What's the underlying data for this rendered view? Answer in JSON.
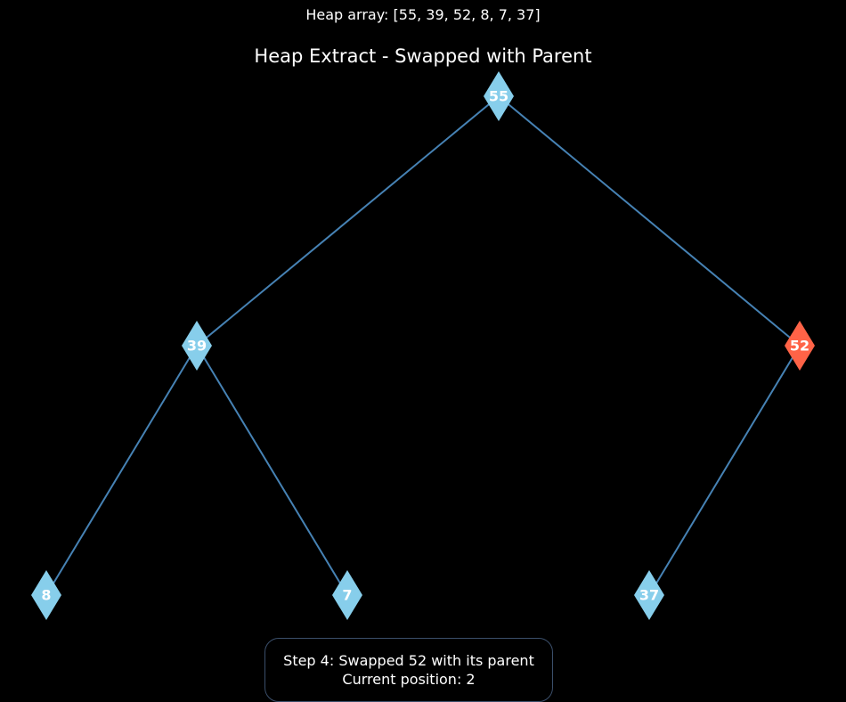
{
  "heap_array_label": "Heap array: [55, 39, 52, 8, 7, 37]",
  "title": "Heap Extract - Swapped with Parent",
  "step": {
    "line1": "Step 4: Swapped 52 with its parent",
    "line2": "Current position: 2"
  },
  "colors": {
    "background": "#000000",
    "node_default": "#87ceeb",
    "node_highlight": "#ff6347",
    "edge": "#4682b4",
    "text": "#ffffff"
  },
  "tree": {
    "nodes": [
      {
        "index": 0,
        "value": "55",
        "highlight": false
      },
      {
        "index": 1,
        "value": "39",
        "highlight": false
      },
      {
        "index": 2,
        "value": "52",
        "highlight": true
      },
      {
        "index": 3,
        "value": "8",
        "highlight": false
      },
      {
        "index": 4,
        "value": "7",
        "highlight": false
      },
      {
        "index": 5,
        "value": "37",
        "highlight": false
      }
    ],
    "edges": [
      [
        0,
        1
      ],
      [
        0,
        2
      ],
      [
        1,
        3
      ],
      [
        1,
        4
      ],
      [
        2,
        5
      ]
    ]
  }
}
